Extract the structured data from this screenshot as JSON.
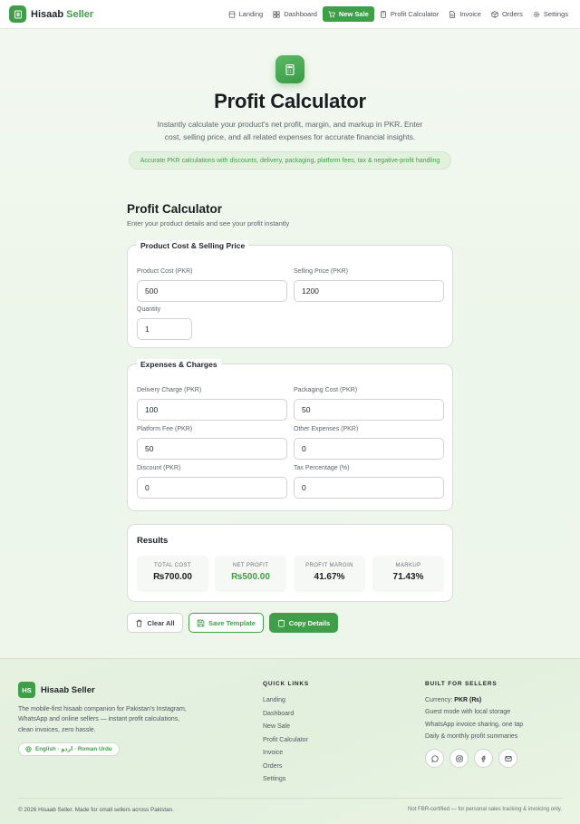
{
  "nav": {
    "brand_main": "Hisaab",
    "brand_accent": "Seller",
    "links": [
      {
        "label": "Landing",
        "icon": "store-icon"
      },
      {
        "label": "Dashboard",
        "icon": "grid-icon"
      },
      {
        "label": "New Sale",
        "icon": "cart-icon",
        "active": true
      },
      {
        "label": "Profit Calculator",
        "icon": "calculator-icon"
      },
      {
        "label": "Invoice",
        "icon": "document-icon"
      },
      {
        "label": "Orders",
        "icon": "box-icon"
      },
      {
        "label": "Settings",
        "icon": "gear-icon"
      }
    ]
  },
  "hero": {
    "title": "Profit Calculator",
    "subtitle_line1": "Instantly calculate your product's net profit, margin, and markup in PKR. Enter",
    "subtitle_line2": "cost, selling price, and all related expenses for accurate financial insights.",
    "pill": "Accurate PKR calculations with discounts, delivery, packaging, platform fees, tax & negative-profit handling"
  },
  "calculator": {
    "title": "Profit Calculator",
    "subtitle": "Enter your product details and see your profit instantly",
    "cost_section": {
      "legend": "Product Cost & Selling Price",
      "product_cost": {
        "label": "Product Cost (PKR)",
        "value": "500"
      },
      "selling_price": {
        "label": "Selling Price (PKR)",
        "value": "1200"
      },
      "quantity": {
        "label": "Quantity",
        "value": "1"
      }
    },
    "expenses_section": {
      "legend": "Expenses & Charges",
      "delivery": {
        "label": "Delivery Charge (PKR)",
        "value": "100"
      },
      "packaging": {
        "label": "Packaging Cost (PKR)",
        "value": "50"
      },
      "platform_fee": {
        "label": "Platform Fee (PKR)",
        "value": "50"
      },
      "other": {
        "label": "Other Expenses (PKR)",
        "value": "0"
      },
      "discount": {
        "label": "Discount (PKR)",
        "value": "0"
      },
      "tax": {
        "label": "Tax Percentage (%)",
        "value": "0"
      }
    },
    "results": {
      "title": "Results",
      "total_cost": {
        "label": "TOTAL COST",
        "value": "₨700.00"
      },
      "net_profit": {
        "label": "NET PROFIT",
        "value": "₨500.00"
      },
      "margin": {
        "label": "PROFIT MARGIN",
        "value": "41.67%"
      },
      "markup": {
        "label": "MARKUP",
        "value": "71.43%"
      }
    },
    "buttons": {
      "clear": "Clear All",
      "template": "Save Template",
      "copy": "Copy Details"
    }
  },
  "footer": {
    "logo_text": "HS",
    "brand": "Hisaab Seller",
    "desc_line1": "The mobile-first hisaab companion for Pakistan's Instagram,",
    "desc_line2": "WhatsApp and online sellers — instant profit calculations,",
    "desc_line3": "clean invoices, zero hassle.",
    "language": "English · اردو · Roman Urdu",
    "quick_links_heading": "QUICK LINKS",
    "quick_links": [
      "Landing",
      "Dashboard",
      "New Sale",
      "Profit Calculator",
      "Invoice",
      "Orders",
      "Settings"
    ],
    "built_heading": "BUILT FOR SELLERS",
    "currency_label": "Currency: ",
    "currency_value": "PKR (₨)",
    "built_items": [
      "Guest mode with local storage",
      "WhatsApp invoice sharing, one tap",
      "Daily & monthly profit summaries"
    ],
    "social": [
      "whatsapp-icon",
      "instagram-icon",
      "facebook-icon",
      "mail-icon"
    ],
    "copyright": "© 2026 Hisaab Seller. Made for small sellers across Pakistan.",
    "note": "Not FBR-certified — for personal sales tracking & invoicing only."
  },
  "colors": {
    "accent": "#3f9f48",
    "background": "#eef6ec"
  }
}
